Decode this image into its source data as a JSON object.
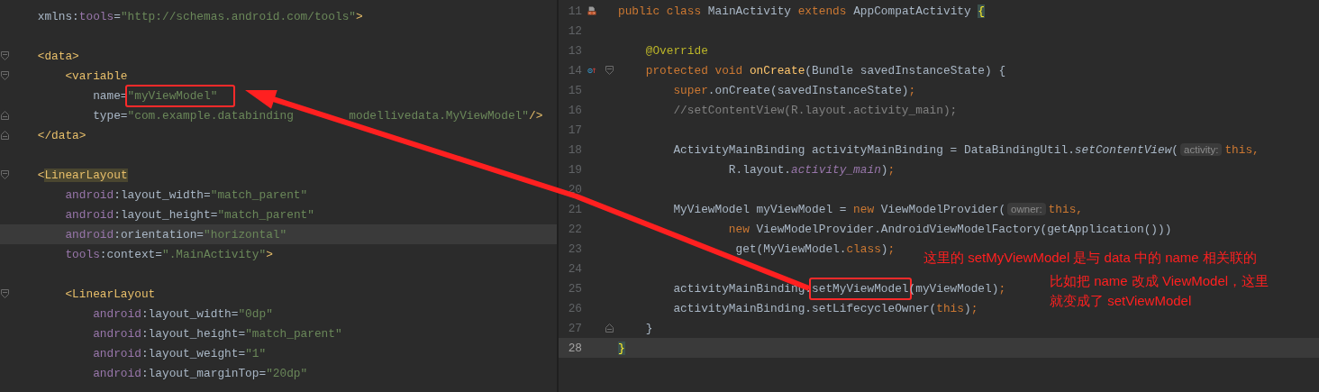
{
  "xml_editor": {
    "lines": [
      {
        "current": false,
        "tokens": [
          {
            "kind": "plain",
            "text": "    xmlns:"
          },
          {
            "kind": "attr",
            "text": "tools"
          },
          {
            "kind": "plain",
            "text": "="
          },
          {
            "kind": "string",
            "text": "\"http://schemas.android.com/tools\""
          },
          {
            "kind": "tag",
            "text": ">"
          }
        ]
      },
      {
        "current": false
      },
      {
        "current": false,
        "fold_marker": {
          "kind": "start"
        },
        "tokens": [
          {
            "kind": "tag",
            "text": "    <data>"
          }
        ]
      },
      {
        "current": false,
        "fold_marker": {
          "kind": "start"
        },
        "tokens": [
          {
            "kind": "tag",
            "text": "        <variable"
          }
        ]
      },
      {
        "current": false,
        "tokens": [
          {
            "kind": "plain",
            "text": "            name="
          },
          {
            "kind": "string",
            "text": "\"myViewModel\"",
            "boxed": true
          }
        ]
      },
      {
        "current": false,
        "fold_marker": {
          "kind": "end"
        },
        "tokens": [
          {
            "kind": "plain",
            "text": "            type="
          },
          {
            "kind": "string",
            "text": "\"com.example.databinding"
          },
          {
            "kind": "string",
            "text": "        modellivedata.MyViewModel\""
          },
          {
            "kind": "tag",
            "text": "/>"
          }
        ]
      },
      {
        "current": false,
        "fold_marker": {
          "kind": "end"
        },
        "tokens": [
          {
            "kind": "tag",
            "text": "    </data>"
          }
        ]
      },
      {
        "current": false
      },
      {
        "current": false,
        "fold_marker": {
          "kind": "start"
        },
        "tokens": [
          {
            "kind": "tag",
            "text": "    <"
          },
          {
            "kind": "tag_match",
            "text": "LinearLayout"
          }
        ]
      },
      {
        "current": false,
        "tokens": [
          {
            "kind": "attr",
            "text": "        android"
          },
          {
            "kind": "plain",
            "text": ":layout_width="
          },
          {
            "kind": "string",
            "text": "\"match_parent\""
          }
        ]
      },
      {
        "current": false,
        "tokens": [
          {
            "kind": "attr",
            "text": "        android"
          },
          {
            "kind": "plain",
            "text": ":layout_height="
          },
          {
            "kind": "string",
            "text": "\"match_parent\""
          }
        ]
      },
      {
        "current": true,
        "tokens": [
          {
            "kind": "attr",
            "text": "        android"
          },
          {
            "kind": "plain",
            "text": ":orientation="
          },
          {
            "kind": "string",
            "text": "\"horizontal\""
          }
        ]
      },
      {
        "current": false,
        "tokens": [
          {
            "kind": "attr",
            "text": "        tools"
          },
          {
            "kind": "plain",
            "text": ":context="
          },
          {
            "kind": "string",
            "text": "\".MainActivity\""
          },
          {
            "kind": "tag",
            "text": ">"
          }
        ]
      },
      {
        "current": false
      },
      {
        "current": false,
        "fold_marker": {
          "kind": "start"
        },
        "tokens": [
          {
            "kind": "tag",
            "text": "        <LinearLayout"
          }
        ]
      },
      {
        "current": false,
        "tokens": [
          {
            "kind": "attr",
            "text": "            android"
          },
          {
            "kind": "plain",
            "text": ":layout_width="
          },
          {
            "kind": "string",
            "text": "\"0dp\""
          }
        ]
      },
      {
        "current": false,
        "tokens": [
          {
            "kind": "attr",
            "text": "            android"
          },
          {
            "kind": "plain",
            "text": ":layout_height="
          },
          {
            "kind": "string",
            "text": "\"match_parent\""
          }
        ]
      },
      {
        "current": false,
        "tokens": [
          {
            "kind": "attr",
            "text": "            android"
          },
          {
            "kind": "plain",
            "text": ":layout_weight="
          },
          {
            "kind": "string",
            "text": "\"1\""
          }
        ]
      },
      {
        "current": false,
        "tokens": [
          {
            "kind": "attr",
            "text": "            android"
          },
          {
            "kind": "plain",
            "text": ":layout_marginTop="
          },
          {
            "kind": "string",
            "text": "\"20dp\""
          }
        ]
      }
    ]
  },
  "java_editor": {
    "lines": [
      {
        "number": "11",
        "current": false,
        "gutter_marker": {
          "kind": "class"
        },
        "tokens": [
          {
            "kind": "keyword",
            "text": "public class "
          },
          {
            "kind": "plain",
            "text": "MainActivity "
          },
          {
            "kind": "keyword",
            "text": "extends "
          },
          {
            "kind": "plain",
            "text": "AppCompatActivity "
          },
          {
            "kind": "brace_match",
            "text": "{"
          }
        ]
      },
      {
        "number": "12",
        "current": false
      },
      {
        "number": "13",
        "current": false,
        "tokens": [
          {
            "kind": "annotation",
            "text": "    @Override"
          }
        ]
      },
      {
        "number": "14",
        "current": false,
        "gutter_marker": {
          "kind": "override"
        },
        "fold_marker": {
          "kind": "start"
        },
        "tokens": [
          {
            "kind": "keyword",
            "text": "    protected void "
          },
          {
            "kind": "method",
            "text": "onCreate"
          },
          {
            "kind": "plain",
            "text": "(Bundle savedInstanceState) {"
          }
        ]
      },
      {
        "number": "15",
        "current": false,
        "tokens": [
          {
            "kind": "keyword",
            "text": "        super"
          },
          {
            "kind": "plain",
            "text": ".onCreate(savedInstanceState)"
          },
          {
            "kind": "keyword",
            "text": ";"
          }
        ]
      },
      {
        "number": "16",
        "current": false,
        "tokens": [
          {
            "kind": "comment",
            "text": "        //setContentView(R.layout.activity_main);"
          }
        ]
      },
      {
        "number": "17",
        "current": false
      },
      {
        "number": "18",
        "current": false,
        "tokens": [
          {
            "kind": "plain",
            "text": "        ActivityMainBinding activityMainBinding = DataBindingUtil."
          },
          {
            "kind": "italic",
            "text": "setContentView"
          },
          {
            "kind": "plain",
            "text": "("
          },
          {
            "kind": "hint",
            "text": "activity:"
          },
          {
            "kind": "keyword",
            "text": "this,"
          }
        ]
      },
      {
        "number": "19",
        "current": false,
        "tokens": [
          {
            "kind": "plain",
            "text": "                R.layout."
          },
          {
            "kind": "field",
            "text": "activity_main"
          },
          {
            "kind": "plain",
            "text": ")"
          },
          {
            "kind": "keyword",
            "text": ";"
          }
        ]
      },
      {
        "number": "20",
        "current": false
      },
      {
        "number": "21",
        "current": false,
        "tokens": [
          {
            "kind": "plain",
            "text": "        MyViewModel myViewModel = "
          },
          {
            "kind": "keyword",
            "text": "new "
          },
          {
            "kind": "plain",
            "text": "ViewModelProvider("
          },
          {
            "kind": "hint",
            "text": "owner:"
          },
          {
            "kind": "keyword",
            "text": "this,"
          }
        ]
      },
      {
        "number": "22",
        "current": false,
        "tokens": [
          {
            "kind": "keyword",
            "text": "                new "
          },
          {
            "kind": "plain",
            "text": "ViewModelProvider.AndroidViewModelFactory(getApplication()))"
          }
        ]
      },
      {
        "number": "23",
        "current": false,
        "tokens": [
          {
            "kind": "plain",
            "text": "                 get(MyViewModel."
          },
          {
            "kind": "keyword",
            "text": "class"
          },
          {
            "kind": "plain",
            "text": ")"
          },
          {
            "kind": "keyword",
            "text": ";"
          }
        ]
      },
      {
        "number": "24",
        "current": false
      },
      {
        "number": "25",
        "current": false,
        "tokens": [
          {
            "kind": "plain",
            "text": "        activityMainBinding."
          },
          {
            "kind": "plain",
            "text": "setMyViewModel",
            "boxed": true
          },
          {
            "kind": "plain",
            "text": "(myViewModel)"
          },
          {
            "kind": "keyword",
            "text": ";"
          }
        ]
      },
      {
        "number": "26",
        "current": false,
        "tokens": [
          {
            "kind": "plain",
            "text": "        activityMainBinding.setLifecycleOwner("
          },
          {
            "kind": "keyword",
            "text": "this"
          },
          {
            "kind": "plain",
            "text": ")"
          },
          {
            "kind": "keyword",
            "text": ";"
          }
        ]
      },
      {
        "number": "27",
        "current": false,
        "fold_marker": {
          "kind": "end"
        },
        "tokens": [
          {
            "kind": "plain",
            "text": "    }"
          }
        ]
      },
      {
        "number": "28",
        "current": true,
        "tokens": [
          {
            "kind": "brace_match",
            "text": "}"
          }
        ]
      }
    ]
  },
  "annotation_notes": [
    "这里的 setMyViewModel 是与 data 中的 name 相关联的",
    "比如把 name 改成 ViewModel，这里",
    "就变成了 setViewModel"
  ]
}
